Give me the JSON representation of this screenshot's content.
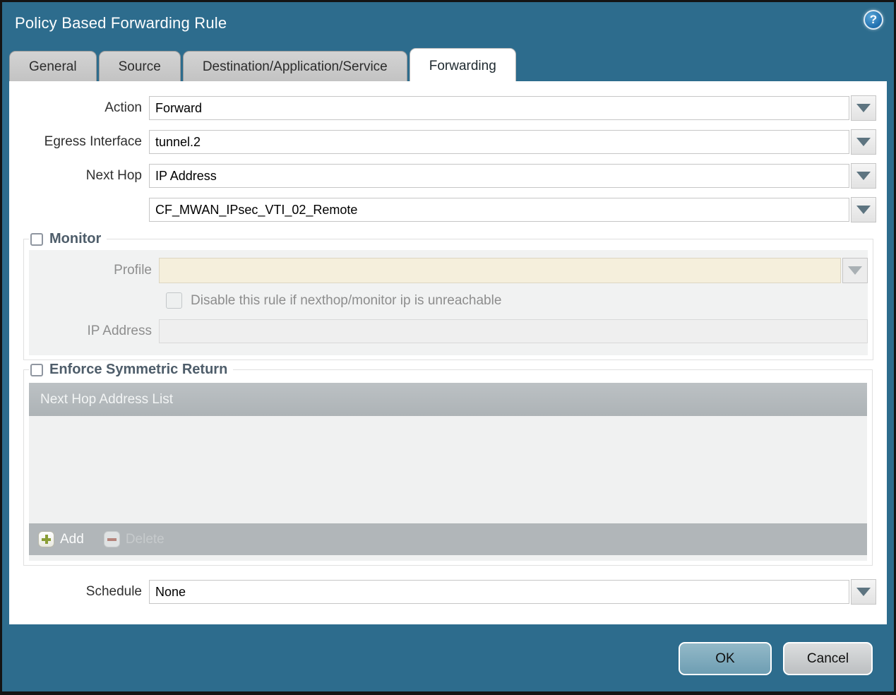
{
  "dialog": {
    "title": "Policy Based Forwarding Rule",
    "help_glyph": "?"
  },
  "tabs": [
    {
      "label": "General",
      "active": false
    },
    {
      "label": "Source",
      "active": false
    },
    {
      "label": "Destination/Application/Service",
      "active": false
    },
    {
      "label": "Forwarding",
      "active": true
    }
  ],
  "form": {
    "action": {
      "label": "Action",
      "value": "Forward"
    },
    "egress_interface": {
      "label": "Egress Interface",
      "value": "tunnel.2"
    },
    "next_hop": {
      "label": "Next Hop",
      "value": "IP Address"
    },
    "next_hop_address": {
      "value": "CF_MWAN_IPsec_VTI_02_Remote"
    },
    "schedule": {
      "label": "Schedule",
      "value": "None"
    }
  },
  "monitor": {
    "title": "Monitor",
    "checked": false,
    "profile": {
      "label": "Profile",
      "value": ""
    },
    "disable_rule": {
      "label": "Disable this rule if nexthop/monitor ip is unreachable",
      "checked": false
    },
    "ip_address": {
      "label": "IP Address",
      "value": ""
    }
  },
  "symmetric_return": {
    "title": "Enforce Symmetric Return",
    "checked": false,
    "table": {
      "header": "Next Hop Address List",
      "rows": []
    },
    "add_label": "Add",
    "delete_label": "Delete"
  },
  "footer": {
    "ok_label": "OK",
    "cancel_label": "Cancel"
  },
  "colors": {
    "dialog_background": "#2d6c8d",
    "active_tab": "#ffffff",
    "inactive_tab": "#c9c9c9",
    "disabled_field_beige": "#f5efdc",
    "section_title": "#4e5d6a",
    "grid_header": "#b2b7ba",
    "ok_button": "#7fa9bd",
    "cancel_button": "#c9cccd"
  }
}
